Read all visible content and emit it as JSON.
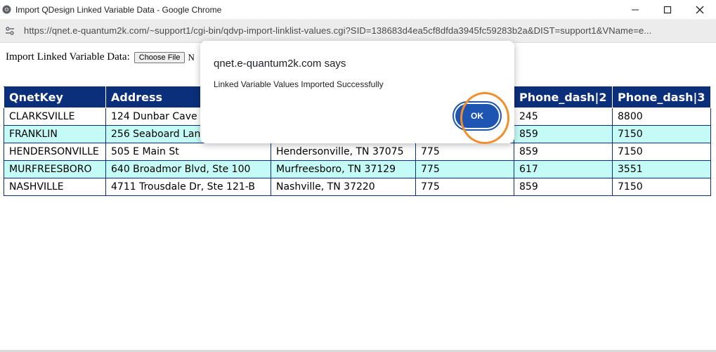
{
  "window": {
    "title": "Import QDesign Linked Variable Data - Google Chrome"
  },
  "addressbar": {
    "url": "https://qnet.e-quantum2k.com/~support1/cgi-bin/qdvp-import-linklist-values.cgi?SID=138683d4ea5cf8dfda3945fc59283b2a&DIST=support1&VName=e..."
  },
  "page": {
    "import_label": "Import Linked Variable Data:",
    "choose_file_label": "Choose File",
    "file_status": "N"
  },
  "table": {
    "headers": [
      "QnetKey",
      "Address",
      "",
      "",
      "Phone_dash|2",
      "Phone_dash|3"
    ],
    "rows": [
      [
        "CLARKSVILLE",
        "124 Dunbar Cave",
        "",
        "",
        "245",
        "8800"
      ],
      [
        "FRANKLIN",
        "256 Seaboard Lan",
        "",
        "",
        "859",
        "7150"
      ],
      [
        "HENDERSONVILLE",
        "505 E Main St",
        "Hendersonville, TN 37075",
        "775",
        "859",
        "7150"
      ],
      [
        "MURFREESBORO",
        "640 Broadmor Blvd, Ste 100",
        "Murfreesboro, TN 37129",
        "775",
        "617",
        "3551"
      ],
      [
        "NASHVILLE",
        "4711 Trousdale Dr, Ste 121-B",
        "Nashville, TN 37220",
        "775",
        "859",
        "7150"
      ]
    ]
  },
  "dialog": {
    "title": "qnet.e-quantum2k.com says",
    "message": "Linked Variable Values Imported Successfully",
    "ok_label": "OK"
  },
  "colors": {
    "header_bg": "#0b2f7a",
    "alt_row_bg": "#c4fbf6",
    "ok_button": "#1e55b3",
    "highlight": "#f28f2c"
  }
}
